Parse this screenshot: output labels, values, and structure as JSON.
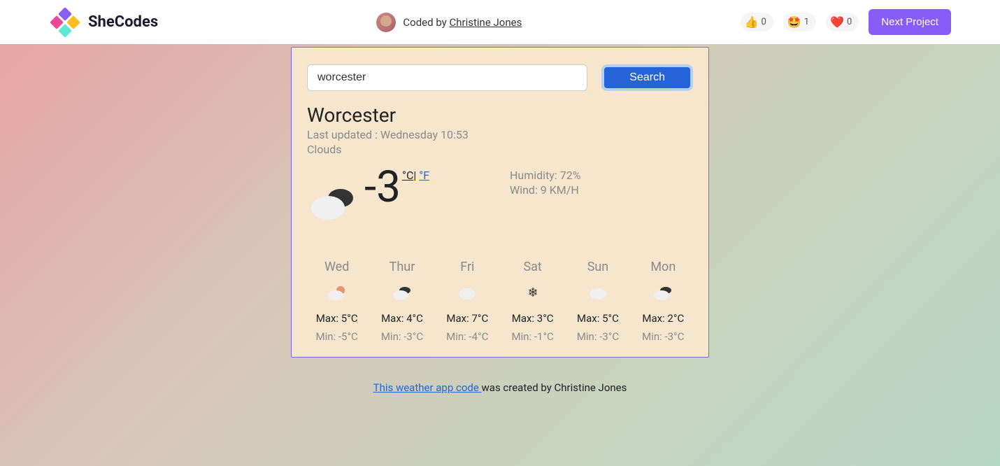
{
  "header": {
    "logo_text": "SheCodes",
    "coded_by_prefix": "Coded by ",
    "author_name": "Christine Jones",
    "reactions": [
      {
        "emoji": "👍",
        "count": "0"
      },
      {
        "emoji": "🤩",
        "count": "1"
      },
      {
        "emoji": "❤️",
        "count": "0"
      }
    ],
    "next_project": "Next Project"
  },
  "search": {
    "value": "worcester",
    "button": "Search"
  },
  "weather": {
    "city": "Worcester",
    "last_updated": "Last updated : Wednesday 10:53",
    "condition": "Clouds",
    "temp": "-3",
    "unit_c": "°C",
    "unit_sep": "| ",
    "unit_f": "°F",
    "humidity": "Humidity: 72%",
    "wind": "Wind: 9 KM/H"
  },
  "forecast": [
    {
      "day": "Wed",
      "icon": "cloud-sun",
      "max": "Max: 5°C",
      "min": "Min: -5°C"
    },
    {
      "day": "Thur",
      "icon": "cloud-dark",
      "max": "Max: 4°C",
      "min": "Min: -3°C"
    },
    {
      "day": "Fri",
      "icon": "cloud",
      "max": "Max: 7°C",
      "min": "Min: -4°C"
    },
    {
      "day": "Sat",
      "icon": "snow",
      "max": "Max: 3°C",
      "min": "Min: -1°C"
    },
    {
      "day": "Sun",
      "icon": "cloud",
      "max": "Max: 5°C",
      "min": "Min: -3°C"
    },
    {
      "day": "Mon",
      "icon": "cloud-dark",
      "max": "Max: 2°C",
      "min": "Min: -3°C"
    }
  ],
  "footer": {
    "link_text": "This weather app code ",
    "after_text": "was created by Christine Jones"
  }
}
